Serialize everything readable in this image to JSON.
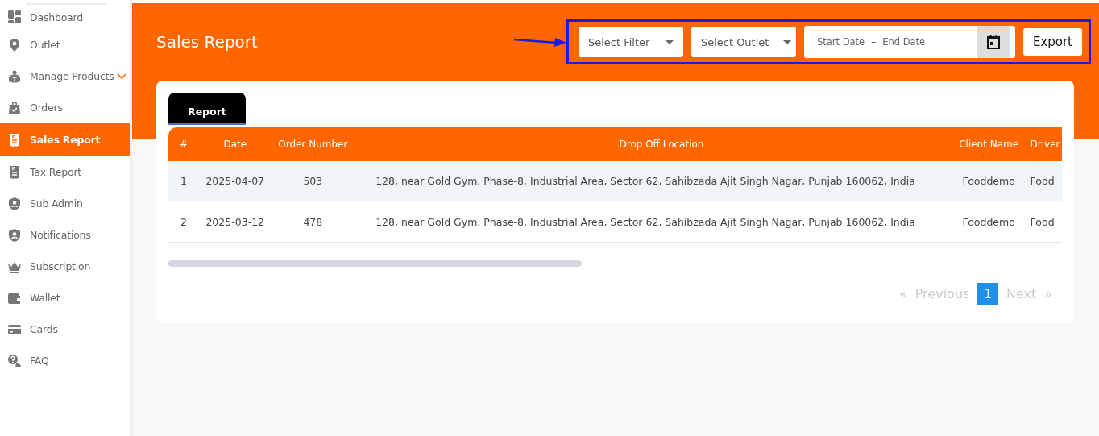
{
  "sidebar": {
    "items": [
      {
        "label": "Dashboard",
        "selected": false
      },
      {
        "label": "Outlet",
        "selected": false
      },
      {
        "label": "Manage Products",
        "selected": false,
        "expandable": true
      },
      {
        "label": "Orders",
        "selected": false
      },
      {
        "label": "Sales Report",
        "selected": true
      },
      {
        "label": "Tax Report",
        "selected": false
      },
      {
        "label": "Sub Admin",
        "selected": false
      },
      {
        "label": "Notifications",
        "selected": false
      },
      {
        "label": "Subscription",
        "selected": false
      },
      {
        "label": "Wallet",
        "selected": false
      },
      {
        "label": "Cards",
        "selected": false
      },
      {
        "label": "FAQ",
        "selected": false
      }
    ]
  },
  "header": {
    "title": "Sales Report",
    "filters": [
      {
        "placeholder": "Select Filter"
      },
      {
        "placeholder": "Select Outlet"
      }
    ],
    "date_range": {
      "start_placeholder": "Start Date",
      "separator": "–",
      "end_placeholder": "End Date"
    },
    "export_button": "Export"
  },
  "tabs": [
    {
      "label": "Report",
      "selected": true
    }
  ],
  "table": {
    "columns": [
      "#",
      "Date",
      "Order Number",
      "Drop Off Location",
      "Client Name",
      "Driver"
    ],
    "rows": [
      {
        "cells": [
          "1",
          "2025-04-07",
          "503",
          "128, near Gold Gym, Phase-8, Industrial Area, Sector 62, Sahibzada Ajit Singh Nagar, Punjab 160062, India",
          "Fooddemo",
          "Food"
        ],
        "selected": true
      },
      {
        "cells": [
          "2",
          "2025-03-12",
          "478",
          "128, near Gold Gym, Phase-8, Industrial Area, Sector 62, Sahibzada Ajit Singh Nagar, Punjab 160062, India",
          "Fooddemo",
          "Food"
        ],
        "selected": false
      }
    ]
  },
  "pagination": {
    "previous": {
      "arrow": "«",
      "label": "Previous",
      "disabled": true
    },
    "pages": [
      {
        "label": "1",
        "selected": true
      }
    ],
    "next": {
      "label": "Next",
      "arrow": "»",
      "disabled": true
    }
  }
}
